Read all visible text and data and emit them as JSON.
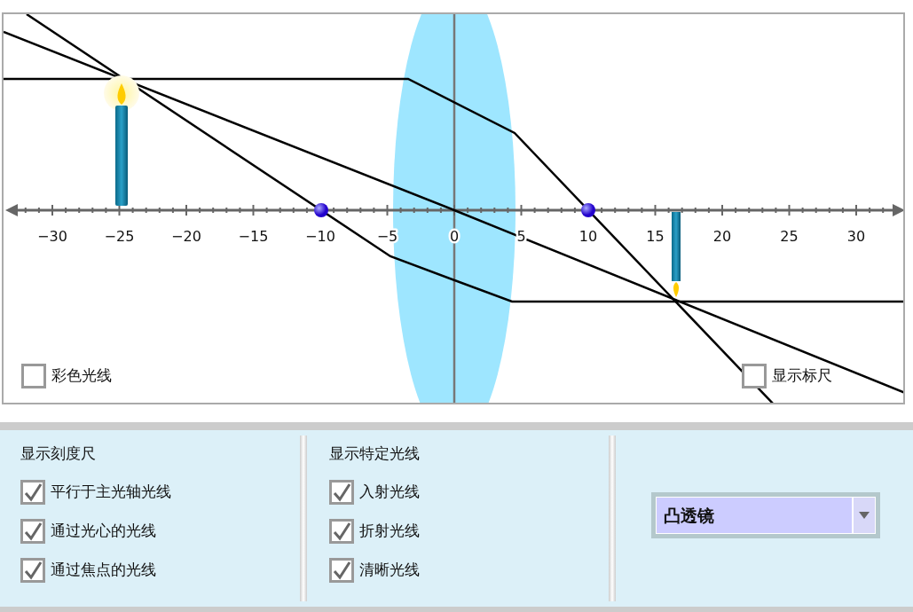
{
  "scene": {
    "tick_labels": [
      "−30",
      "−25",
      "−20",
      "−15",
      "−10",
      "−5",
      "0",
      "5",
      "10",
      "15",
      "20",
      "25",
      "30"
    ],
    "options": [
      {
        "label": "彩色光线",
        "checked": false
      },
      {
        "label": "显示标尺",
        "checked": false
      }
    ]
  },
  "panel": {
    "sections": [
      {
        "title": "显示刻度尺",
        "options": [
          {
            "label": "平行于主光轴光线",
            "checked": true
          },
          {
            "label": "通过光心的光线",
            "checked": true
          },
          {
            "label": "通过焦点的光线",
            "checked": true
          }
        ]
      },
      {
        "title": "显示特定光线",
        "options": [
          {
            "label": "入射光线",
            "checked": true
          },
          {
            "label": "折射光线",
            "checked": true
          },
          {
            "label": "清晰光线",
            "checked": true
          }
        ]
      }
    ],
    "lens_type": {
      "value": "凸透镜"
    }
  }
}
